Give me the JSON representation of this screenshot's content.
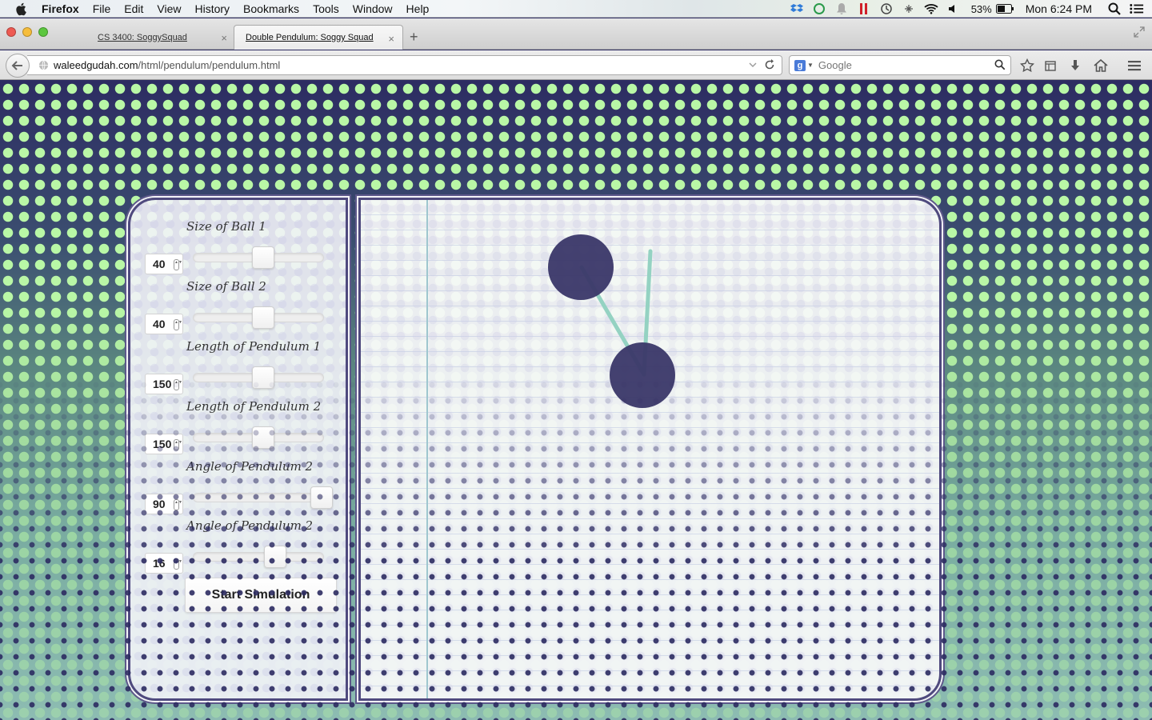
{
  "menubar": {
    "app_name": "Firefox",
    "items": [
      "File",
      "Edit",
      "View",
      "History",
      "Bookmarks",
      "Tools",
      "Window",
      "Help"
    ],
    "battery": "53%",
    "clock": "Mon 6:24 PM"
  },
  "tabs": [
    {
      "label": "CS 3400: SoggySquad",
      "close": "×"
    },
    {
      "label": "Double Pendulum: Soggy Squad",
      "close": "×"
    }
  ],
  "new_tab": "+",
  "url": {
    "domain": "waleedgudah.com",
    "path": "/html/pendulum/pendulum.html"
  },
  "search": {
    "engine_letter": "g",
    "placeholder": "Google"
  },
  "controls": [
    {
      "label": "Size of Ball 1",
      "value": "40",
      "slider_fraction": 0.5
    },
    {
      "label": "Size of Ball 2",
      "value": "40",
      "slider_fraction": 0.5
    },
    {
      "label": "Length of Pendulum 1",
      "value": "150",
      "slider_fraction": 0.5
    },
    {
      "label": "Length of Pendulum 2",
      "value": "150",
      "slider_fraction": 0.5
    },
    {
      "label": "Angle of Pendulum 2",
      "value": "90",
      "slider_fraction": 1.0
    },
    {
      "label": "Angle of Pendulum 2",
      "value": "16",
      "slider_fraction": 0.6
    }
  ],
  "start_button": "Start Simulation",
  "colors": {
    "ball": "#3a3768",
    "rod": "#94d2c2",
    "accent_green": "#b9f7a6",
    "background_navy": "#2d2c62"
  }
}
